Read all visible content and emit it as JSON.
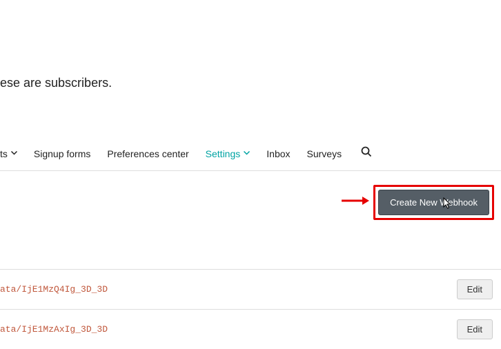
{
  "header": {
    "text": "ese are subscribers."
  },
  "nav": {
    "item0_label": "ts",
    "item1_label": "Signup forms",
    "item2_label": "Preferences center",
    "item3_label": "Settings",
    "item4_label": "Inbox",
    "item5_label": "Surveys"
  },
  "actions": {
    "create_webhook_label": "Create New Webhook"
  },
  "list": {
    "items": [
      {
        "url": "ata/IjE1MzQ4Ig_3D_3D",
        "edit_label": "Edit"
      },
      {
        "url": "ata/IjE1MzAxIg_3D_3D",
        "edit_label": "Edit"
      }
    ]
  }
}
